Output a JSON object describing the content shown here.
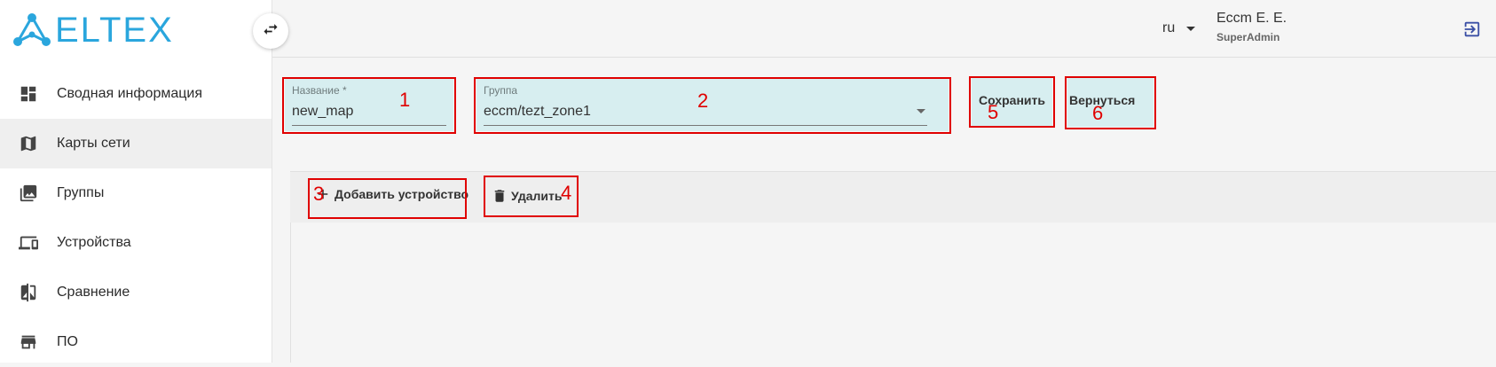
{
  "brand": {
    "logo_text": "ELTEX",
    "color": "#2aa6dd"
  },
  "sidebar": {
    "items": [
      {
        "label": "Сводная информация",
        "icon": "dashboard-icon",
        "active": false
      },
      {
        "label": "Карты сети",
        "icon": "map-icon",
        "active": true
      },
      {
        "label": "Группы",
        "icon": "photo-library-icon",
        "active": false
      },
      {
        "label": "Устройства",
        "icon": "devices-icon",
        "active": false
      },
      {
        "label": "Сравнение",
        "icon": "compare-icon",
        "active": false
      },
      {
        "label": "ПО",
        "icon": "store-icon",
        "active": false
      }
    ]
  },
  "header": {
    "lang": "ru",
    "user_name": "Eccm E. E.",
    "user_role": "SuperAdmin"
  },
  "form": {
    "name_label": "Название *",
    "name_value": "new_map",
    "group_label": "Группа",
    "group_value": "eccm/tezt_zone1",
    "save_label": "Сохранить",
    "back_label": "Вернуться"
  },
  "toolbar": {
    "add_label": "Добавить устройство",
    "delete_label": "Удалить"
  },
  "annotations": [
    "1",
    "2",
    "3",
    "4",
    "5",
    "6"
  ],
  "colors": {
    "highlight": "#d7eef0",
    "annotation": "#e00000"
  }
}
